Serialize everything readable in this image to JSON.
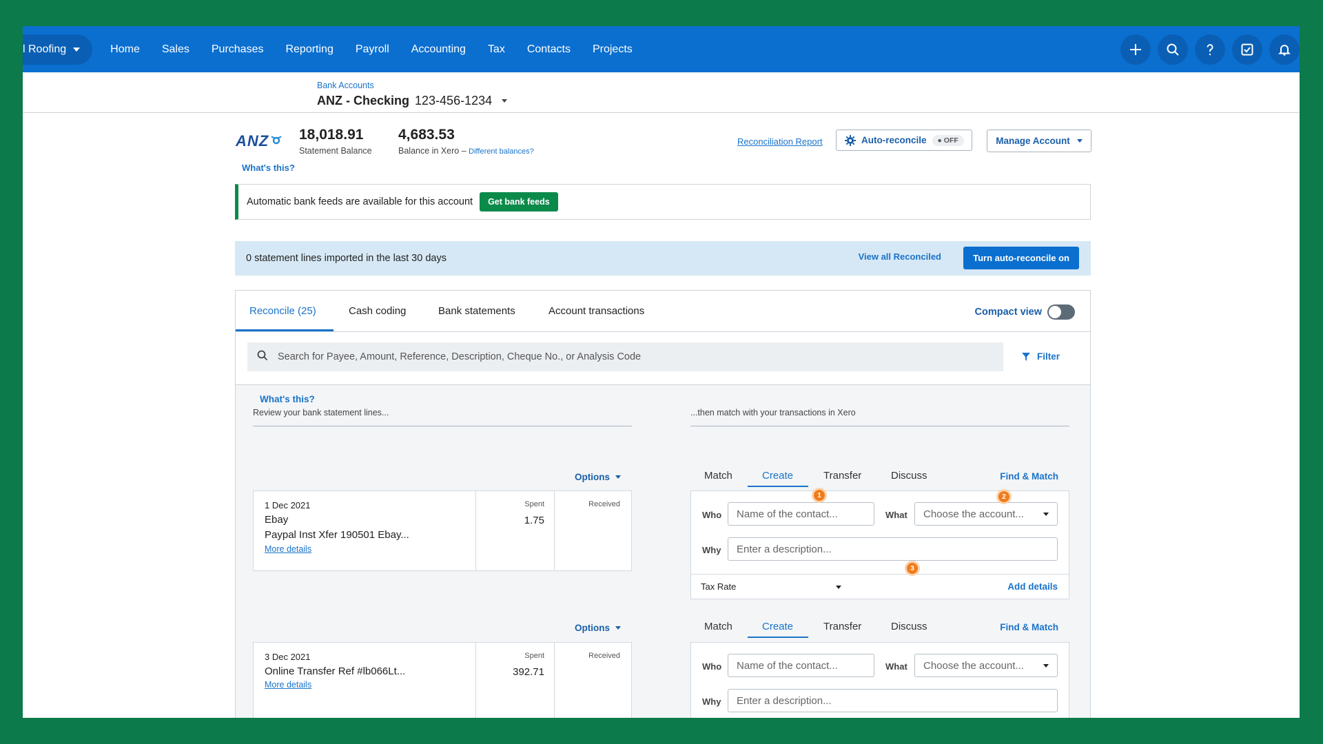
{
  "topnav": {
    "org_name": "l Roofing",
    "items": [
      "Home",
      "Sales",
      "Purchases",
      "Reporting",
      "Payroll",
      "Accounting",
      "Tax",
      "Contacts",
      "Projects"
    ],
    "icons": [
      "plus-icon",
      "search-icon",
      "help-icon",
      "checklist-icon",
      "bell-icon"
    ]
  },
  "header": {
    "breadcrumb": "Bank Accounts",
    "account_name": "ANZ - Checking",
    "account_number": "123-456-1234"
  },
  "balances": {
    "bank_logo": "ANZ",
    "statement_balance": "18,018.91",
    "statement_label": "Statement Balance",
    "xero_balance": "4,683.53",
    "xero_label": "Balance in Xero –",
    "different_link": "Different balances?",
    "whats_this": "What's this?"
  },
  "actions": {
    "reconciliation_report": "Reconciliation Report",
    "auto_reconcile": "Auto-reconcile",
    "auto_reconcile_state": "OFF",
    "manage_account": "Manage Account"
  },
  "feeds_banner": {
    "text": "Automatic bank feeds are available for this account",
    "button": "Get bank feeds"
  },
  "imported_bar": {
    "text": "0 statement lines imported in the last 30 days",
    "view_all": "View all Reconciled",
    "turn_on": "Turn auto-reconcile on"
  },
  "tabs": {
    "items": [
      "Reconcile (25)",
      "Cash coding",
      "Bank statements",
      "Account transactions"
    ],
    "active_index": 0,
    "compact_view": "Compact view"
  },
  "search": {
    "placeholder": "Search for Payee, Amount, Reference, Description, Cheque No., or Analysis Code",
    "filter": "Filter"
  },
  "reconcile": {
    "whats_this": "What's this?",
    "review_text": "Review your bank statement lines...",
    "match_text": "...then match with your transactions in Xero",
    "options_label": "Options",
    "spent_label": "Spent",
    "received_label": "Received",
    "more_details": "More details",
    "match_tabs": [
      "Match",
      "Create",
      "Transfer",
      "Discuss"
    ],
    "find_match": "Find & Match",
    "who_label": "Who",
    "what_label": "What",
    "why_label": "Why",
    "who_placeholder": "Name of the contact...",
    "what_placeholder": "Choose the account...",
    "why_placeholder": "Enter a description...",
    "tax_rate": "Tax Rate",
    "add_details": "Add details",
    "lines": [
      {
        "date": "1 Dec 2021",
        "payee": "Ebay",
        "description": "Paypal Inst Xfer 190501 Ebay...",
        "spent": "1.75"
      },
      {
        "date": "3 Dec 2021",
        "payee": "",
        "description": "Online Transfer Ref #lb066Lt...",
        "spent": "392.71"
      }
    ],
    "badges": [
      "1",
      "2",
      "3"
    ]
  },
  "colors": {
    "nav_blue": "#0b6fd0",
    "link_blue": "#1a73c9",
    "green": "#0c8a4a",
    "badge_orange": "#f07c1b"
  }
}
